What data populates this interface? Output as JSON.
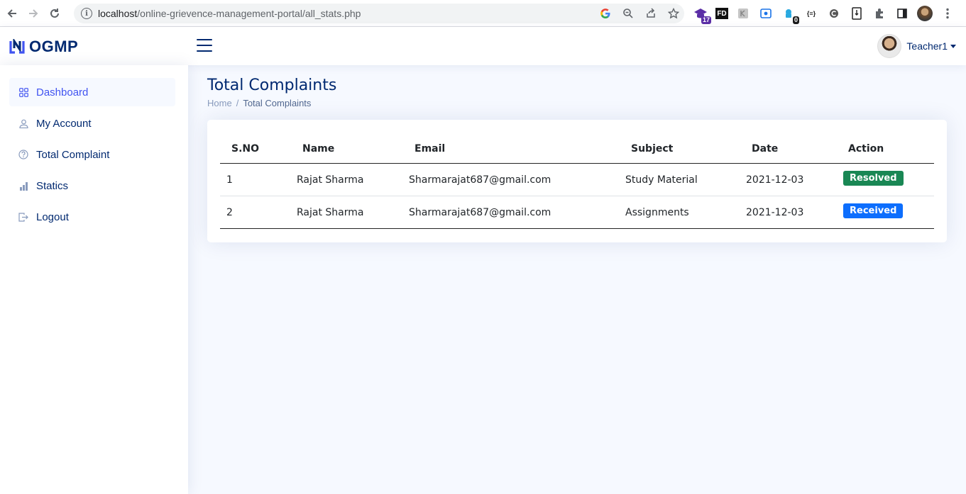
{
  "browser": {
    "url_host": "localhost",
    "url_path": "/online-grievence-management-portal/all_stats.php",
    "extension_badges": [
      "17",
      "0"
    ],
    "ext_labels": [
      "FD",
      "{≡}"
    ]
  },
  "header": {
    "logo_text": "OGMP",
    "user_name": "Teacher1"
  },
  "sidebar": {
    "items": [
      {
        "label": "Dashboard",
        "icon": "grid-icon",
        "active": true
      },
      {
        "label": "My Account",
        "icon": "person-icon",
        "active": false
      },
      {
        "label": "Total Complaint",
        "icon": "question-circle-icon",
        "active": false
      },
      {
        "label": "Statics",
        "icon": "bar-chart-icon",
        "active": false
      },
      {
        "label": "Logout",
        "icon": "box-arrow-right-icon",
        "active": false
      }
    ]
  },
  "main": {
    "title": "Total Complaints",
    "breadcrumb": {
      "home": "Home",
      "separator": "/",
      "current": "Total Complaints"
    }
  },
  "table": {
    "columns": [
      "S.NO",
      "Name",
      "Email",
      "Subject",
      "Date",
      "Action"
    ],
    "rows": [
      {
        "sno": "1",
        "name": "Rajat Sharma",
        "email": "Sharmarajat687@gmail.com",
        "subject": "Study Material",
        "date": "2021-12-03",
        "action": "Resolved",
        "action_color": "#198754"
      },
      {
        "sno": "2",
        "name": "Rajat Sharma",
        "email": "Sharmarajat687@gmail.com",
        "subject": "Assignments",
        "date": "2021-12-03",
        "action": "Received",
        "action_color": "#0d6efd"
      }
    ]
  },
  "colors": {
    "primary": "#4154f1",
    "navy": "#012970",
    "background": "#f6f9ff"
  }
}
